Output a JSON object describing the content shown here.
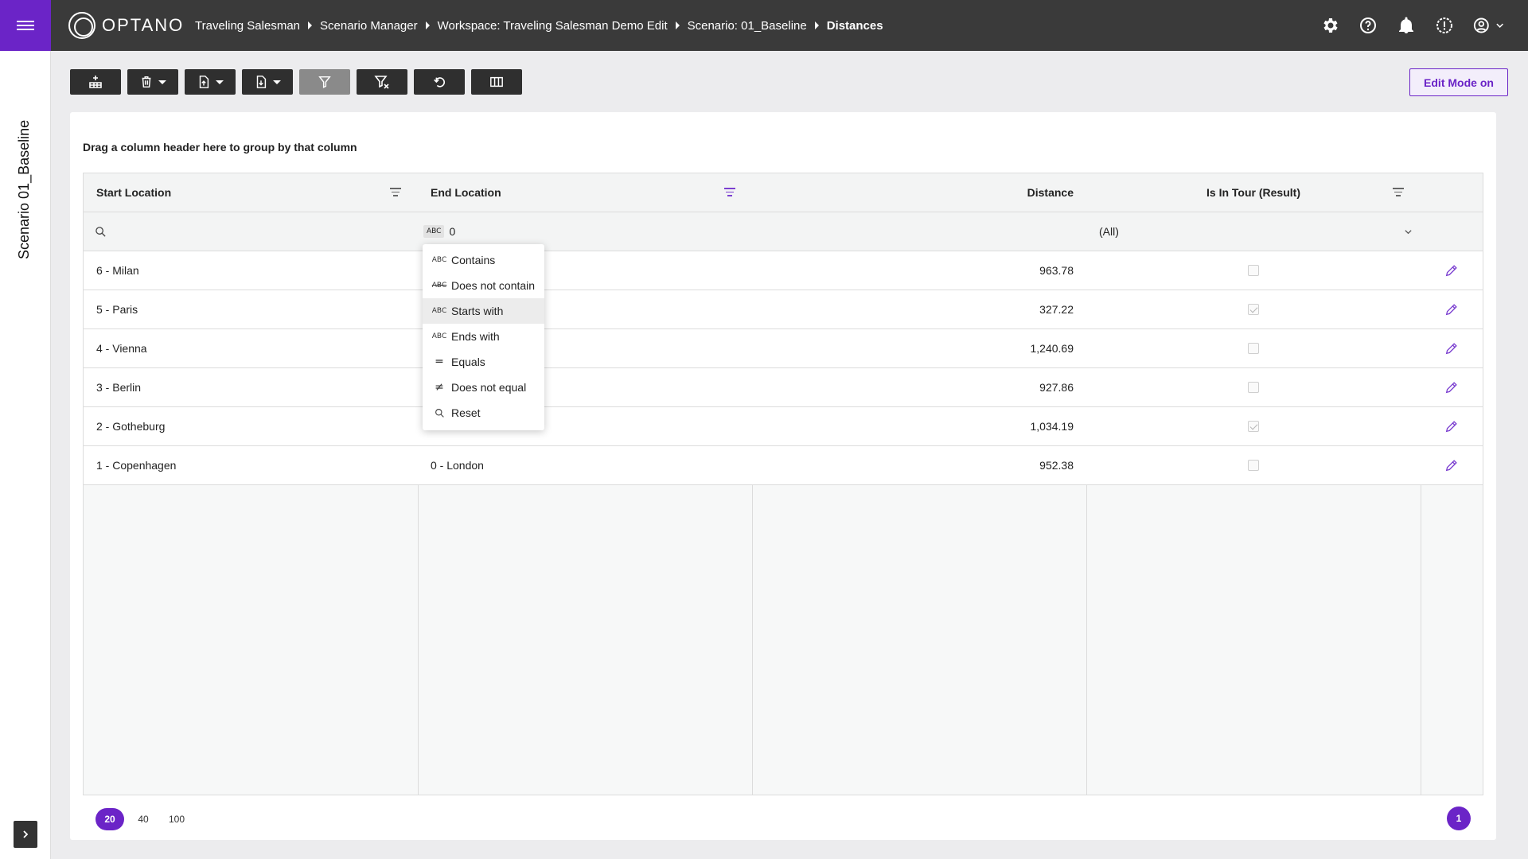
{
  "header": {
    "logo_text": "OPTANO",
    "breadcrumb": [
      "Traveling Salesman",
      "Scenario Manager",
      "Workspace: Traveling Salesman Demo Edit",
      "Scenario: 01_Baseline"
    ],
    "current": "Distances",
    "icons": [
      "gear-icon",
      "help-icon",
      "bell-icon",
      "alert-icon",
      "account-icon"
    ]
  },
  "sidebar": {
    "title": "Scenario 01_Baseline"
  },
  "toolbar": {
    "buttons": [
      "add-row",
      "delete",
      "import",
      "export",
      "filter",
      "clear-filter",
      "undo",
      "columns"
    ],
    "edit_mode_label": "Edit Mode on"
  },
  "grid": {
    "group_hint": "Drag a column header here to group by that column",
    "columns": [
      "Start Location",
      "End Location",
      "Distance",
      "Is In Tour (Result)"
    ],
    "filter_row": {
      "end_location_value": "0",
      "is_in_tour_value": "(All)"
    },
    "rows": [
      {
        "start": "6 - Milan",
        "end": "",
        "distance": "963.78",
        "in_tour": false
      },
      {
        "start": "5 - Paris",
        "end": "",
        "distance": "327.22",
        "in_tour": true
      },
      {
        "start": "4 - Vienna",
        "end": "",
        "distance": "1,240.69",
        "in_tour": false
      },
      {
        "start": "3 - Berlin",
        "end": "",
        "distance": "927.86",
        "in_tour": false
      },
      {
        "start": "2 - Gotheburg",
        "end": "",
        "distance": "1,034.19",
        "in_tour": true
      },
      {
        "start": "1 - Copenhagen",
        "end": "0 - London",
        "distance": "952.38",
        "in_tour": false
      }
    ]
  },
  "filter_menu": {
    "items": [
      "Contains",
      "Does not contain",
      "Starts with",
      "Ends with",
      "Equals",
      "Does not equal",
      "Reset"
    ],
    "highlighted": "Starts with"
  },
  "pager": {
    "sizes": [
      "20",
      "40",
      "100"
    ],
    "active_size": "20",
    "current_page": "1"
  },
  "colors": {
    "accent": "#6b24c7",
    "topbar": "#3a3a3a"
  }
}
